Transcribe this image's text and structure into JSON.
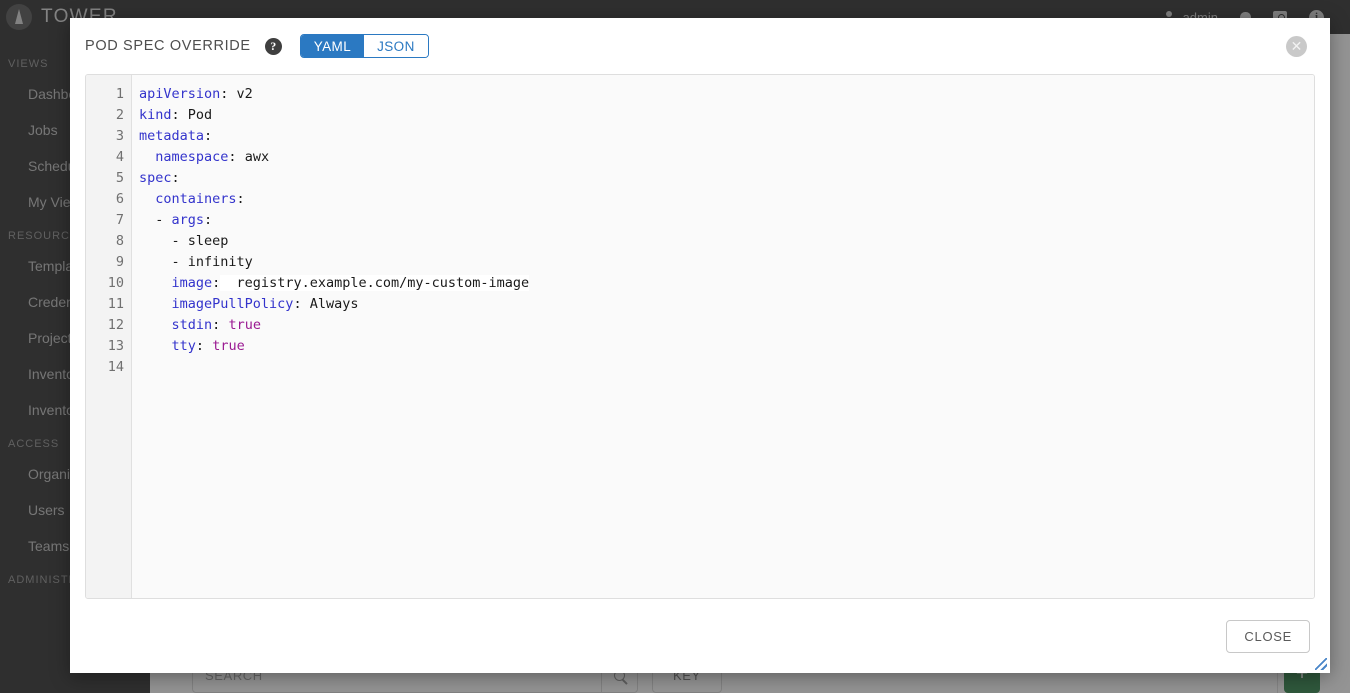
{
  "app": {
    "brand": "TOWER",
    "topbar": {
      "user": "admin",
      "person_icon": "person-icon",
      "bell_icon": "bell-icon",
      "apps_icon": "apps-icon",
      "info_icon": "info-icon"
    },
    "sidebar": {
      "groups": [
        {
          "label": "VIEWS",
          "items": [
            {
              "label": "Dashboard"
            },
            {
              "label": "Jobs"
            },
            {
              "label": "Schedules"
            },
            {
              "label": "My View"
            }
          ]
        },
        {
          "label": "RESOURCES",
          "items": [
            {
              "label": "Templates"
            },
            {
              "label": "Credentials"
            },
            {
              "label": "Projects"
            },
            {
              "label": "Inventories"
            },
            {
              "label": "Inventory Scripts"
            }
          ]
        },
        {
          "label": "ACCESS",
          "items": [
            {
              "label": "Organizations"
            },
            {
              "label": "Users"
            },
            {
              "label": "Teams"
            }
          ]
        },
        {
          "label": "ADMINISTRATION",
          "items": []
        }
      ]
    },
    "toolbar": {
      "search_placeholder": "SEARCH",
      "search_icon": "search-icon",
      "key_label": "KEY",
      "add_label": "+"
    }
  },
  "modal": {
    "title": "POD SPEC OVERRIDE",
    "help_icon": "help-icon",
    "close_icon": "close-icon",
    "format_toggle": {
      "options": [
        "YAML",
        "JSON"
      ],
      "selected": "YAML",
      "yaml_label": "YAML",
      "json_label": "JSON"
    },
    "footer": {
      "close_label": "CLOSE"
    },
    "resize_handle": "resize-grip-icon"
  },
  "editor": {
    "language": "yaml",
    "line_count": 14,
    "line_numbers": [
      "1",
      "2",
      "3",
      "4",
      "5",
      "6",
      "7",
      "8",
      "9",
      "10",
      "11",
      "12",
      "13",
      "14"
    ],
    "raw_text": "apiVersion: v2\nkind: Pod\nmetadata:\n  namespace: awx\nspec:\n  containers:\n  - args:\n    - sleep\n    - infinity\n    image:  registry.example.com/my-custom-image\n    imagePullPolicy: Always\n    stdin: true\n    tty: true\n",
    "lines": [
      {
        "n": 1,
        "tokens": [
          {
            "t": "apiVersion",
            "c": "key"
          },
          {
            "t": ":",
            "c": "punc"
          },
          {
            "t": " v2",
            "c": "val"
          }
        ]
      },
      {
        "n": 2,
        "tokens": [
          {
            "t": "kind",
            "c": "key"
          },
          {
            "t": ":",
            "c": "punc"
          },
          {
            "t": " Pod",
            "c": "val"
          }
        ]
      },
      {
        "n": 3,
        "tokens": [
          {
            "t": "metadata",
            "c": "key"
          },
          {
            "t": ":",
            "c": "punc"
          }
        ]
      },
      {
        "n": 4,
        "tokens": [
          {
            "t": "  ",
            "c": "val"
          },
          {
            "t": "namespace",
            "c": "key"
          },
          {
            "t": ":",
            "c": "punc"
          },
          {
            "t": " awx",
            "c": "val"
          }
        ]
      },
      {
        "n": 5,
        "tokens": [
          {
            "t": "spec",
            "c": "key"
          },
          {
            "t": ":",
            "c": "punc"
          }
        ]
      },
      {
        "n": 6,
        "tokens": [
          {
            "t": "  ",
            "c": "val"
          },
          {
            "t": "containers",
            "c": "key"
          },
          {
            "t": ":",
            "c": "punc"
          }
        ]
      },
      {
        "n": 7,
        "tokens": [
          {
            "t": "  - ",
            "c": "dash"
          },
          {
            "t": "args",
            "c": "key"
          },
          {
            "t": ":",
            "c": "punc"
          }
        ]
      },
      {
        "n": 8,
        "tokens": [
          {
            "t": "    - sleep",
            "c": "val"
          }
        ]
      },
      {
        "n": 9,
        "tokens": [
          {
            "t": "    - infinity",
            "c": "val"
          }
        ]
      },
      {
        "n": 10,
        "tokens": [
          {
            "t": "    ",
            "c": "val"
          },
          {
            "t": "image",
            "c": "key"
          },
          {
            "t": ":",
            "c": "punc"
          },
          {
            "t": "  registry.example.com/my-custom-image",
            "c": "hl"
          }
        ]
      },
      {
        "n": 11,
        "tokens": [
          {
            "t": "    ",
            "c": "val"
          },
          {
            "t": "imagePullPolicy",
            "c": "key"
          },
          {
            "t": ":",
            "c": "punc"
          },
          {
            "t": " Always",
            "c": "val"
          }
        ]
      },
      {
        "n": 12,
        "tokens": [
          {
            "t": "    ",
            "c": "val"
          },
          {
            "t": "stdin",
            "c": "key"
          },
          {
            "t": ":",
            "c": "punc"
          },
          {
            "t": " ",
            "c": "val"
          },
          {
            "t": "true",
            "c": "bool"
          }
        ]
      },
      {
        "n": 13,
        "tokens": [
          {
            "t": "    ",
            "c": "val"
          },
          {
            "t": "tty",
            "c": "key"
          },
          {
            "t": ":",
            "c": "punc"
          },
          {
            "t": " ",
            "c": "val"
          },
          {
            "t": "true",
            "c": "bool"
          }
        ]
      },
      {
        "n": 14,
        "tokens": []
      }
    ]
  },
  "colors": {
    "accent_blue": "#2b79c2",
    "key_blue": "#3434cc",
    "bool_purple": "#9b1a92",
    "sidebar_dark": "#1f1f1f",
    "add_green": "#1f7a3d",
    "editor_bg": "#fafafa",
    "gutter_bg": "#f3f3f3"
  }
}
